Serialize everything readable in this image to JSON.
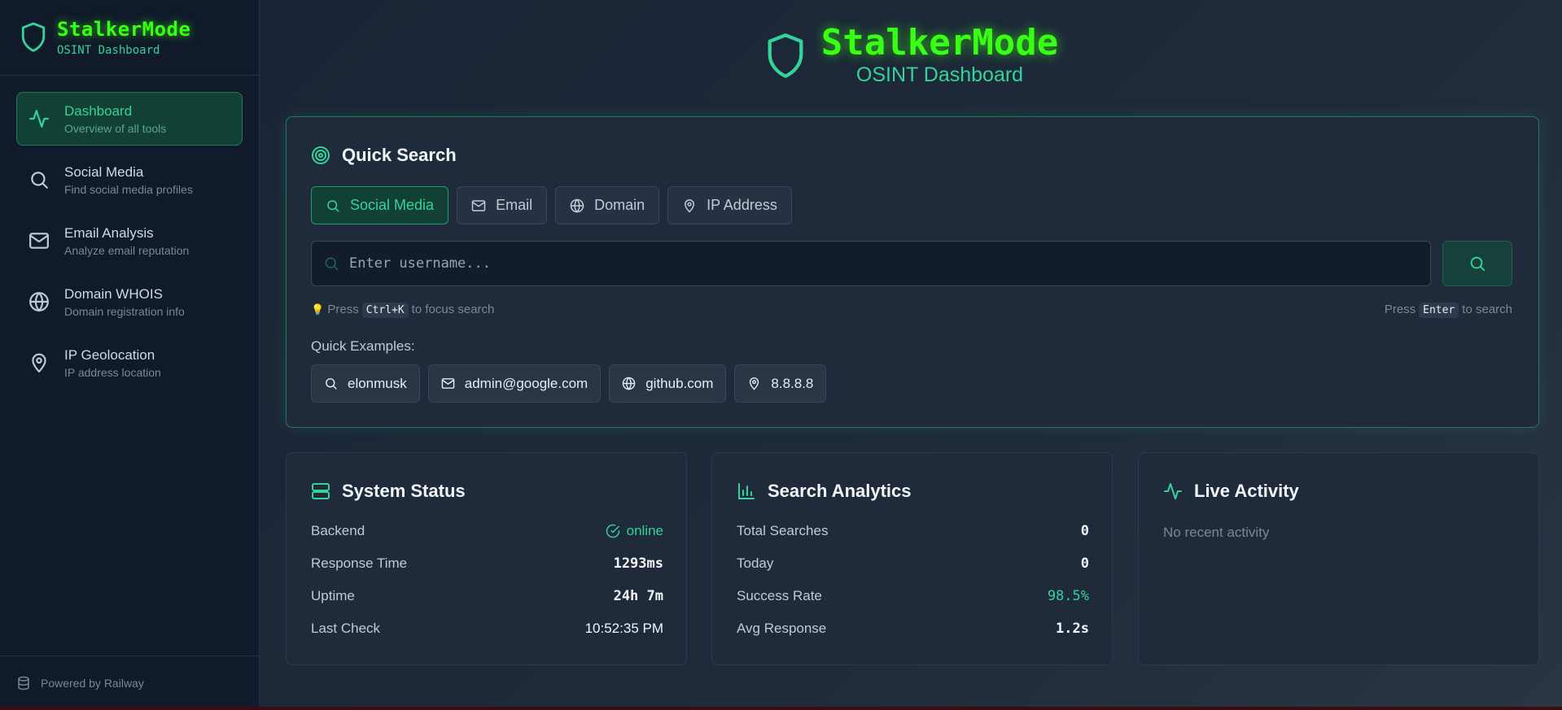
{
  "app": {
    "title": "StalkerMode",
    "subtitle": "OSINT Dashboard"
  },
  "sidebar": {
    "items": [
      {
        "label": "Dashboard",
        "desc": "Overview of all tools",
        "icon": "activity-icon",
        "active": true
      },
      {
        "label": "Social Media",
        "desc": "Find social media profiles",
        "icon": "search-icon"
      },
      {
        "label": "Email Analysis",
        "desc": "Analyze email reputation",
        "icon": "mail-icon"
      },
      {
        "label": "Domain WHOIS",
        "desc": "Domain registration info",
        "icon": "globe-icon"
      },
      {
        "label": "IP Geolocation",
        "desc": "IP address location",
        "icon": "map-pin-icon"
      }
    ],
    "footer": "Powered by Railway"
  },
  "quick_search": {
    "title": "Quick Search",
    "tabs": [
      {
        "label": "Social Media",
        "icon": "search-icon",
        "active": true
      },
      {
        "label": "Email",
        "icon": "mail-icon"
      },
      {
        "label": "Domain",
        "icon": "globe-icon"
      },
      {
        "label": "IP Address",
        "icon": "map-pin-icon"
      }
    ],
    "input_value": "",
    "placeholder": "Enter username...",
    "hint_left_pre": "Press",
    "hint_left_key": "Ctrl+K",
    "hint_left_post": "to focus search",
    "hint_right_pre": "Press",
    "hint_right_key": "Enter",
    "hint_right_post": "to search",
    "examples_label": "Quick Examples:",
    "examples": [
      {
        "label": "elonmusk",
        "icon": "search-icon"
      },
      {
        "label": "admin@google.com",
        "icon": "mail-icon"
      },
      {
        "label": "github.com",
        "icon": "globe-icon"
      },
      {
        "label": "8.8.8.8",
        "icon": "map-pin-icon"
      }
    ]
  },
  "system_status": {
    "title": "System Status",
    "rows": [
      {
        "label": "Backend",
        "value": "online"
      },
      {
        "label": "Response Time",
        "value": "1293ms"
      },
      {
        "label": "Uptime",
        "value": "24h 7m"
      },
      {
        "label": "Last Check",
        "value": "10:52:35 PM"
      }
    ]
  },
  "search_analytics": {
    "title": "Search Analytics",
    "rows": [
      {
        "label": "Total Searches",
        "value": "0"
      },
      {
        "label": "Today",
        "value": "0"
      },
      {
        "label": "Success Rate",
        "value": "98.5%"
      },
      {
        "label": "Avg Response",
        "value": "1.2s"
      }
    ]
  },
  "live_activity": {
    "title": "Live Activity",
    "empty": "No recent activity"
  },
  "colors": {
    "accent": "#34d399",
    "neon": "#39ff14",
    "bg": "#1c2535"
  }
}
